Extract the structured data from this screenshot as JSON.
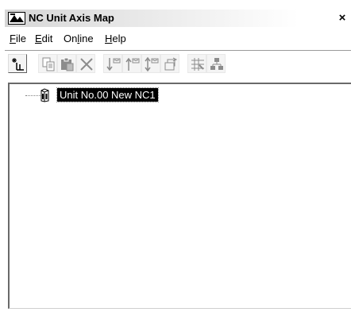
{
  "window": {
    "title": "NC Unit Axis Map",
    "close_glyph": "×"
  },
  "menu": {
    "items": [
      {
        "label": "File",
        "mnemonic": "F",
        "rest": "ile"
      },
      {
        "label": "Edit",
        "mnemonic": "E",
        "rest": "dit"
      },
      {
        "label": "Online",
        "pre": "On",
        "mnemonic": "l",
        "rest": "ine"
      },
      {
        "label": "Help",
        "mnemonic": "H",
        "rest": "elp"
      }
    ]
  },
  "toolbar": {
    "buttons": [
      {
        "icon": "new-unit-icon",
        "enabled": true
      },
      {
        "icon": "copy-icon",
        "enabled": false
      },
      {
        "icon": "paste-icon",
        "enabled": false
      },
      {
        "icon": "delete-icon",
        "enabled": false
      },
      {
        "icon": "download-icon",
        "enabled": false
      },
      {
        "icon": "upload-icon",
        "enabled": false
      },
      {
        "icon": "compare-icon",
        "enabled": false
      },
      {
        "icon": "transfer-icon",
        "enabled": false
      },
      {
        "icon": "settings-grid-icon",
        "enabled": false
      },
      {
        "icon": "network-icon",
        "enabled": false
      }
    ]
  },
  "tree": {
    "nodes": [
      {
        "label": "Unit No.00 New NC1",
        "icon": "nc-unit-icon",
        "selected": true
      }
    ]
  },
  "colors": {
    "selection_bg": "#000000",
    "selection_fg": "#ffffff",
    "disabled_icon": "#8c8c8c"
  }
}
